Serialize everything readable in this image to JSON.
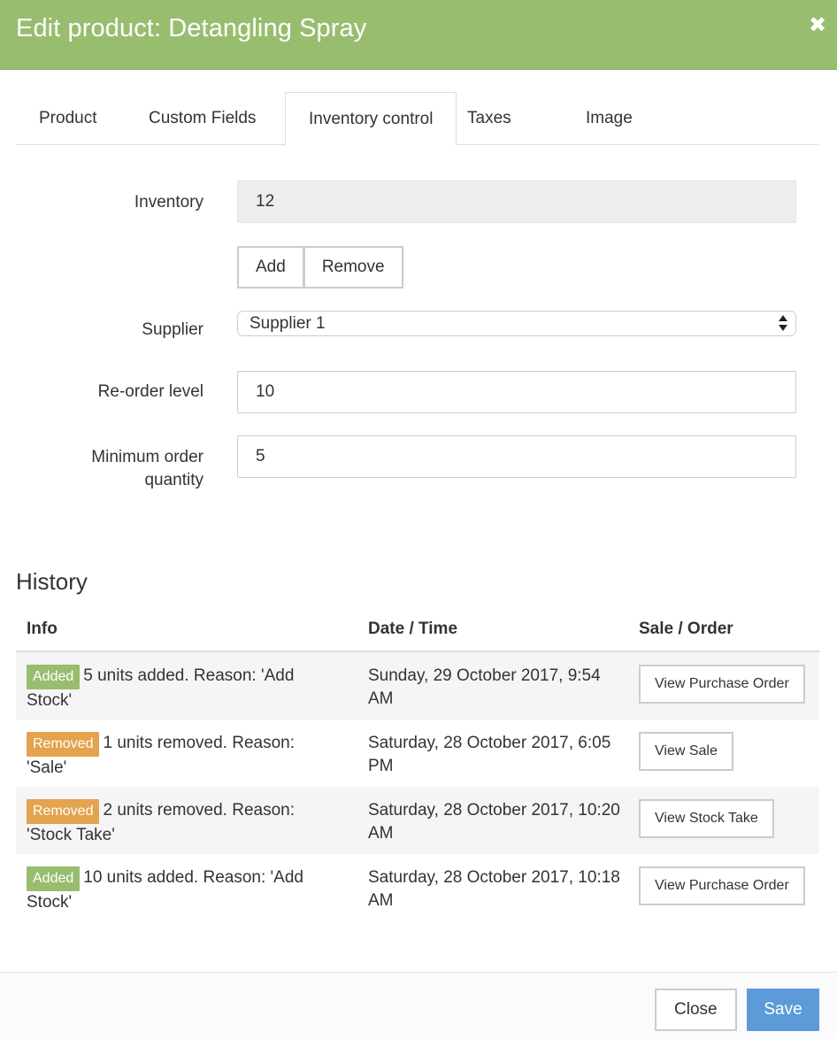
{
  "modal": {
    "title": "Edit product: Detangling Spray"
  },
  "tabs": [
    {
      "label": "Product"
    },
    {
      "label": "Custom Fields"
    },
    {
      "label": "Inventory control"
    },
    {
      "label": "Taxes"
    },
    {
      "label": "Image"
    }
  ],
  "active_tab": "Inventory control",
  "inventory": {
    "label": "Inventory",
    "value": "12",
    "add_label": "Add",
    "remove_label": "Remove"
  },
  "supplier": {
    "label": "Supplier",
    "selected": "Supplier 1"
  },
  "reorder_level": {
    "label": "Re-order level",
    "value": "10"
  },
  "min_order": {
    "label_line1": "Minimum order",
    "label_line2": "quantity",
    "value": "5"
  },
  "history": {
    "title": "History",
    "columns": [
      "Info",
      "Date / Time",
      "Sale / Order"
    ],
    "rows": [
      {
        "badge": "Added",
        "badge_type": "added",
        "info": "5 units added. Reason: 'Add Stock'",
        "date": "Sunday, 29 October 2017, 9:54 AM",
        "action": "View Purchase Order"
      },
      {
        "badge": "Removed",
        "badge_type": "removed",
        "info": "1 units removed. Reason: 'Sale'",
        "date": "Saturday, 28 October 2017, 6:05 PM",
        "action": "View Sale"
      },
      {
        "badge": "Removed",
        "badge_type": "removed",
        "info": "2 units removed. Reason: 'Stock Take'",
        "date": "Saturday, 28 October 2017, 10:20 AM",
        "action": "View Stock Take"
      },
      {
        "badge": "Added",
        "badge_type": "added",
        "info": "10 units added. Reason: 'Add Stock'",
        "date": "Saturday, 28 October 2017, 10:18 AM",
        "action": "View Purchase Order"
      }
    ]
  },
  "footer": {
    "close_label": "Close",
    "save_label": "Save"
  },
  "colors": {
    "header": "#98bd6f",
    "badge_added": "#98bd6f",
    "badge_removed": "#e3a34f",
    "save_button": "#5c9bd8"
  },
  "icons": {
    "close": "close-icon",
    "select": "select-arrows-icon"
  }
}
